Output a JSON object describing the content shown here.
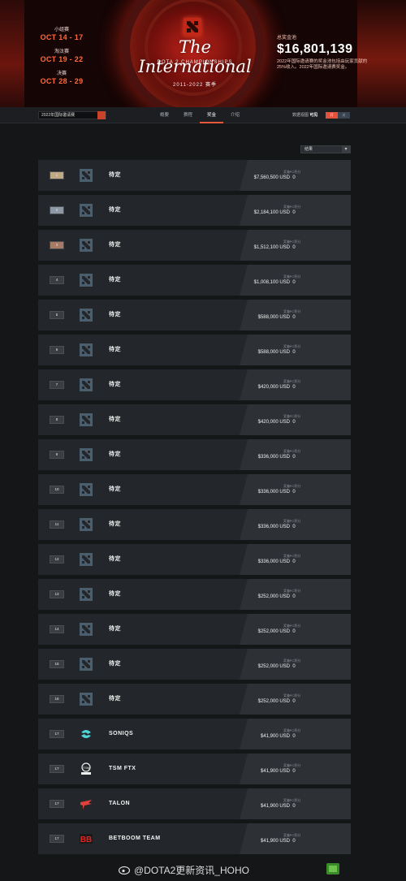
{
  "header": {
    "dates": [
      {
        "label": "小组赛",
        "value": "OCT 14 - 17"
      },
      {
        "label": "淘汰赛",
        "value": "OCT 19 - 22"
      },
      {
        "label": "决赛",
        "value": "OCT 28 - 29"
      }
    ],
    "title": "The International",
    "subtitle": "DOTA 2 CHAMPIONSHIPS",
    "season": "2011-2022  赛季",
    "prize_pool_label": "总奖金池",
    "prize_pool": "$16,801,139",
    "prize_pool_desc": "2022年国际邀请赛的奖金池包括由玩家贡献的25%收入。2022年国际邀请赛奖金。"
  },
  "nav": {
    "event_select": "2022年国际邀请赛",
    "tabs": [
      "概要",
      "赛程",
      "奖金",
      "介绍"
    ],
    "active_tab": "奖金",
    "toggle_label": "数据视图",
    "toggle_bold": "可见",
    "toggle_on": "开",
    "toggle_off": "关"
  },
  "filter": {
    "label": "结果"
  },
  "labels": {
    "prize": "奖金",
    "dpc": "DPC积分"
  },
  "rows": [
    {
      "rank": "1",
      "tier": "gold",
      "team": "待定",
      "logo": "dota-icon",
      "prize": "$7,560,500 USD",
      "dpc": "0"
    },
    {
      "rank": "2",
      "tier": "silver",
      "team": "待定",
      "logo": "dota-icon",
      "prize": "$2,184,100 USD",
      "dpc": "0"
    },
    {
      "rank": "3",
      "tier": "bronze",
      "team": "待定",
      "logo": "dota-icon",
      "prize": "$1,512,100 USD",
      "dpc": "0"
    },
    {
      "rank": "4",
      "tier": "plain",
      "team": "待定",
      "logo": "dota-icon",
      "prize": "$1,008,100 USD",
      "dpc": "0"
    },
    {
      "rank": "5",
      "tier": "plain",
      "team": "待定",
      "logo": "dota-icon",
      "prize": "$588,000 USD",
      "dpc": "0"
    },
    {
      "rank": "6",
      "tier": "plain",
      "team": "待定",
      "logo": "dota-icon",
      "prize": "$588,000 USD",
      "dpc": "0"
    },
    {
      "rank": "7",
      "tier": "plain",
      "team": "待定",
      "logo": "dota-icon",
      "prize": "$420,000 USD",
      "dpc": "0"
    },
    {
      "rank": "8",
      "tier": "plain",
      "team": "待定",
      "logo": "dota-icon",
      "prize": "$420,000 USD",
      "dpc": "0"
    },
    {
      "rank": "9",
      "tier": "plain",
      "team": "待定",
      "logo": "dota-icon",
      "prize": "$336,000 USD",
      "dpc": "0"
    },
    {
      "rank": "10",
      "tier": "plain",
      "team": "待定",
      "logo": "dota-icon",
      "prize": "$336,000 USD",
      "dpc": "0"
    },
    {
      "rank": "11",
      "tier": "plain",
      "team": "待定",
      "logo": "dota-icon",
      "prize": "$336,000 USD",
      "dpc": "0"
    },
    {
      "rank": "12",
      "tier": "plain",
      "team": "待定",
      "logo": "dota-icon",
      "prize": "$336,000 USD",
      "dpc": "0"
    },
    {
      "rank": "13",
      "tier": "plain",
      "team": "待定",
      "logo": "dota-icon",
      "prize": "$252,000 USD",
      "dpc": "0"
    },
    {
      "rank": "14",
      "tier": "plain",
      "team": "待定",
      "logo": "dota-icon",
      "prize": "$252,000 USD",
      "dpc": "0"
    },
    {
      "rank": "15",
      "tier": "plain",
      "team": "待定",
      "logo": "dota-icon",
      "prize": "$252,000 USD",
      "dpc": "0"
    },
    {
      "rank": "16",
      "tier": "plain",
      "team": "待定",
      "logo": "dota-icon",
      "prize": "$252,000 USD",
      "dpc": "0"
    },
    {
      "rank": "17",
      "tier": "plain",
      "team": "SONIQS",
      "logo": "soniqs-logo",
      "prize": "$41,900 USD",
      "dpc": "0"
    },
    {
      "rank": "17",
      "tier": "plain",
      "team": "TSM FTX",
      "logo": "tsm-logo",
      "prize": "$41,900 USD",
      "dpc": "0"
    },
    {
      "rank": "17",
      "tier": "plain",
      "team": "TALON",
      "logo": "talon-logo",
      "prize": "$41,900 USD",
      "dpc": "0"
    },
    {
      "rank": "17",
      "tier": "plain",
      "team": "BETBOOM TEAM",
      "logo": "betboom-logo",
      "prize": "$41,900 USD",
      "dpc": "0"
    }
  ],
  "watermark": "@DOTA2更新资讯_HOHO"
}
